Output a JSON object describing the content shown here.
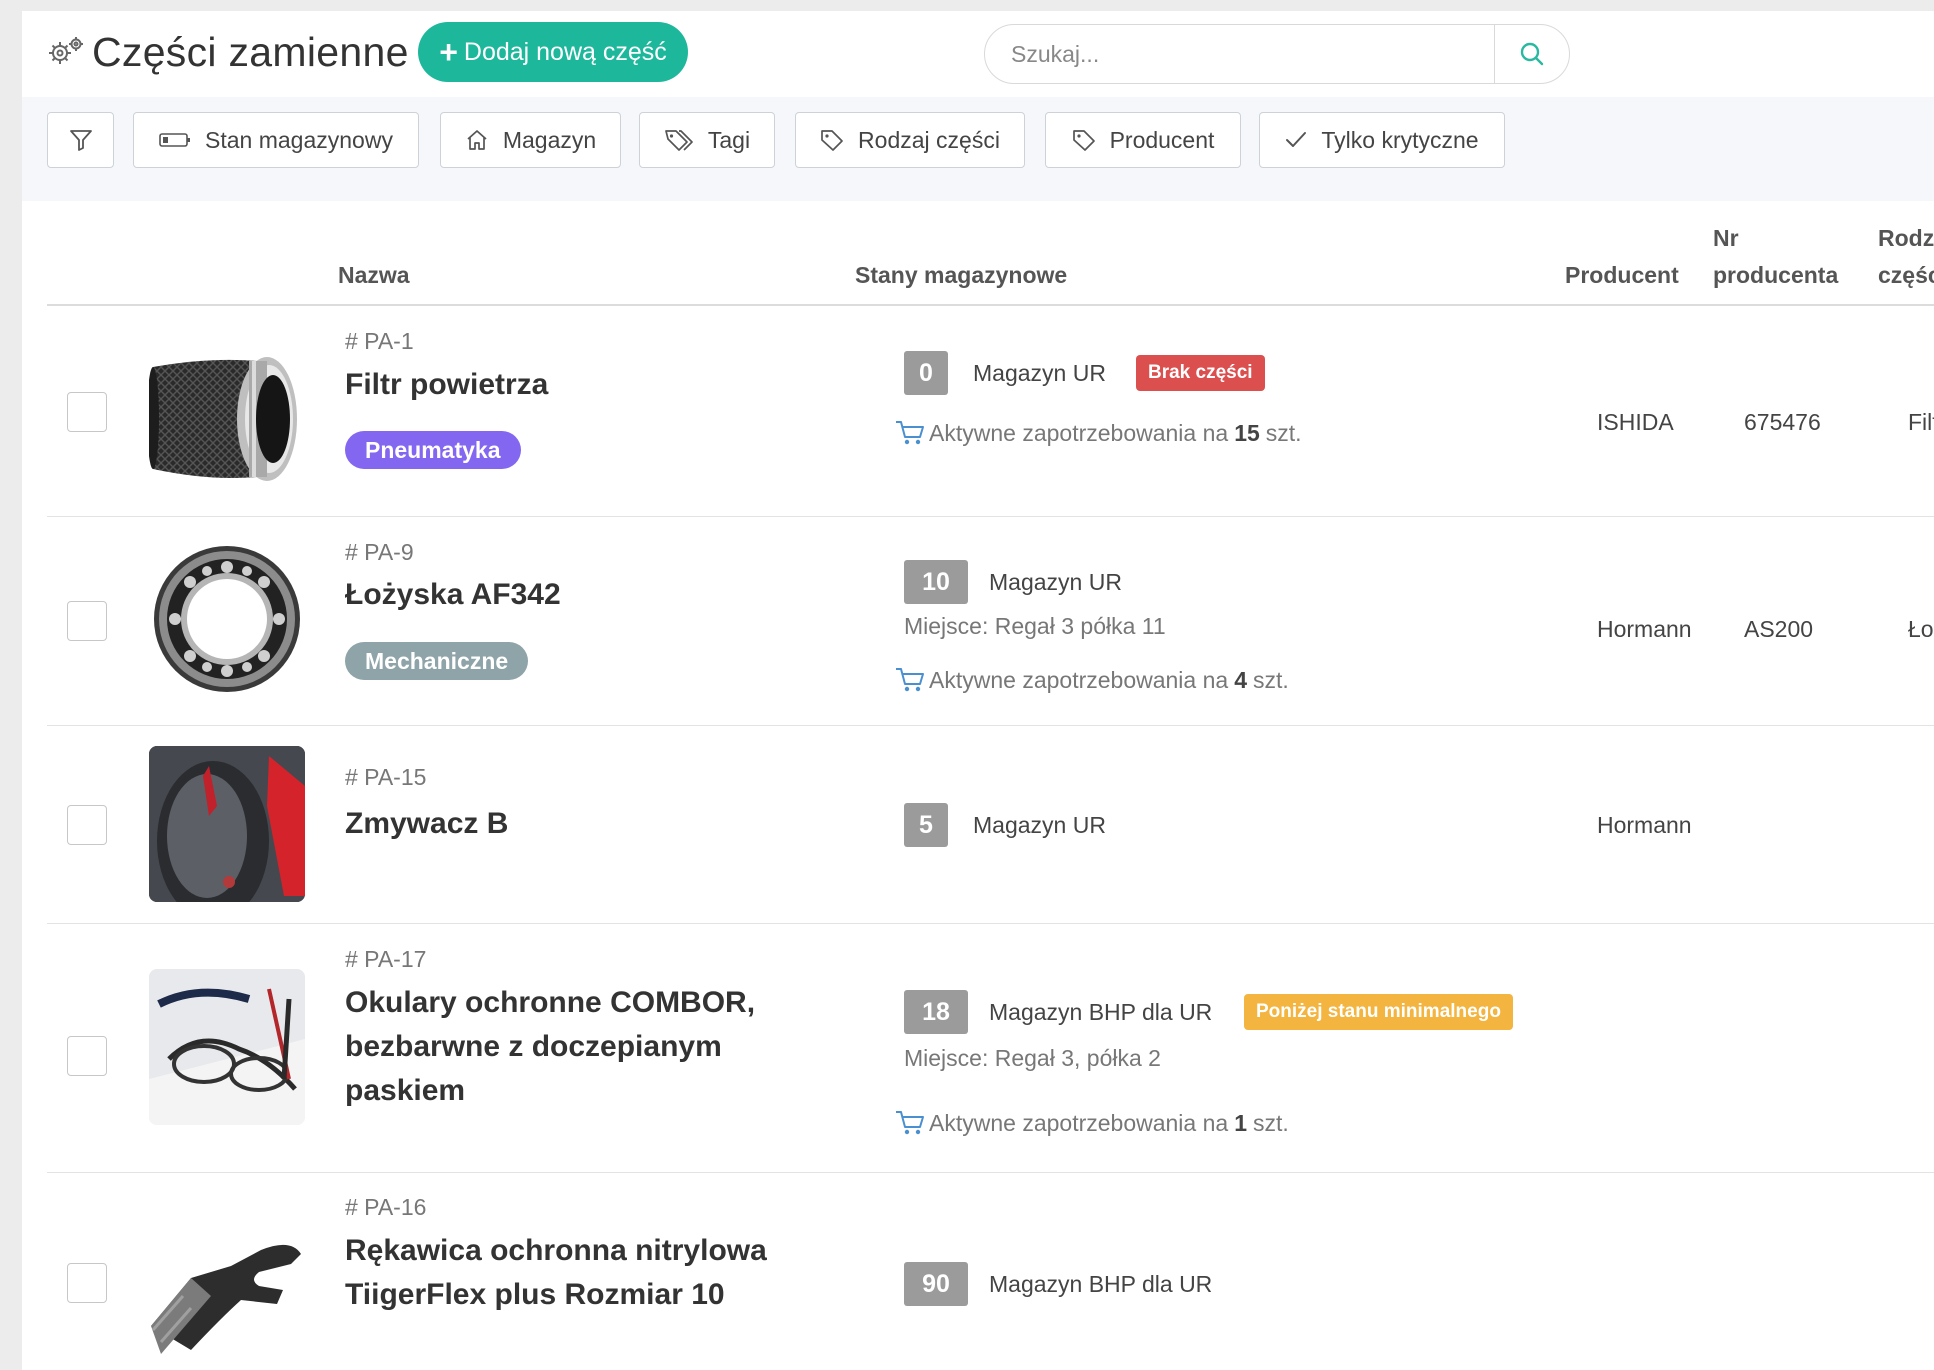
{
  "header": {
    "title": "Części zamienne",
    "title_icon": "gears-icon",
    "add_button_label": "Dodaj nową część",
    "add_button_color": "#1db89b",
    "search_placeholder": "Szukaj..."
  },
  "filters": [
    {
      "label": "",
      "icon": "filter-icon"
    },
    {
      "label": "Stan magazynowy",
      "icon": "battery-icon"
    },
    {
      "label": "Magazyn",
      "icon": "home-icon"
    },
    {
      "label": "Tagi",
      "icon": "tags-icon"
    },
    {
      "label": "Rodzaj części",
      "icon": "tag-icon"
    },
    {
      "label": "Producent",
      "icon": "tag-icon"
    },
    {
      "label": "Tylko krytyczne",
      "icon": "check-icon"
    }
  ],
  "table": {
    "columns": {
      "name": "Nazwa",
      "stock": "Stany magazynowe",
      "producer": "Producent",
      "producer_no_line1": "Nr",
      "producer_no_line2": "producenta",
      "type_line1": "Rodzaj",
      "type_line2": "części"
    },
    "rows": [
      {
        "id": "# PA-1",
        "name": "Filtr powietrza",
        "tag": "Pneumatyka",
        "tag_color": "#8467f0",
        "qty": "0",
        "warehouse": "Magazyn UR",
        "badge": "Brak części",
        "badge_color": "#dc4f4f",
        "place": "",
        "demand_prefix": "Aktywne zapotrzebowania na",
        "demand_qty": "15",
        "demand_suffix": "szt.",
        "producer": "ISHIDA",
        "producer_no": "675476",
        "type": "Filtr"
      },
      {
        "id": "# PA-9",
        "name": "Łożyska AF342",
        "tag": "Mechaniczne",
        "tag_color": "#8ea4a8",
        "qty": "10",
        "warehouse": "Magazyn UR",
        "badge": "",
        "place": "Miejsce: Regał 3 półka 11",
        "demand_prefix": "Aktywne zapotrzebowania na",
        "demand_qty": "4",
        "demand_suffix": "szt.",
        "producer": "Hormann",
        "producer_no": "AS200",
        "type": "Łożyska"
      },
      {
        "id": "# PA-15",
        "name": "Zmywacz B",
        "tag": "",
        "qty": "5",
        "warehouse": "Magazyn UR",
        "badge": "",
        "place": "",
        "producer": "Hormann",
        "producer_no": "",
        "type": ""
      },
      {
        "id": "# PA-17",
        "name": "Okulary ochronne COMBOR, bezbarwne z doczepianym paskiem",
        "tag": "",
        "qty": "18",
        "warehouse": "Magazyn BHP dla UR",
        "badge": "Poniżej stanu minimalnego",
        "badge_color": "#f3b440",
        "place": "Miejsce: Regał 3, półka 2",
        "demand_prefix": "Aktywne zapotrzebowania na",
        "demand_qty": "1",
        "demand_suffix": "szt.",
        "producer": "",
        "producer_no": "",
        "type": ""
      },
      {
        "id": "# PA-16",
        "name": "Rękawica ochronna nitrylowa TiigerFlex plus Rozmiar 10",
        "tag": "",
        "qty": "90",
        "warehouse": "Magazyn BHP dla UR",
        "badge": "",
        "place": "",
        "producer": "",
        "producer_no": "",
        "type": ""
      }
    ]
  }
}
